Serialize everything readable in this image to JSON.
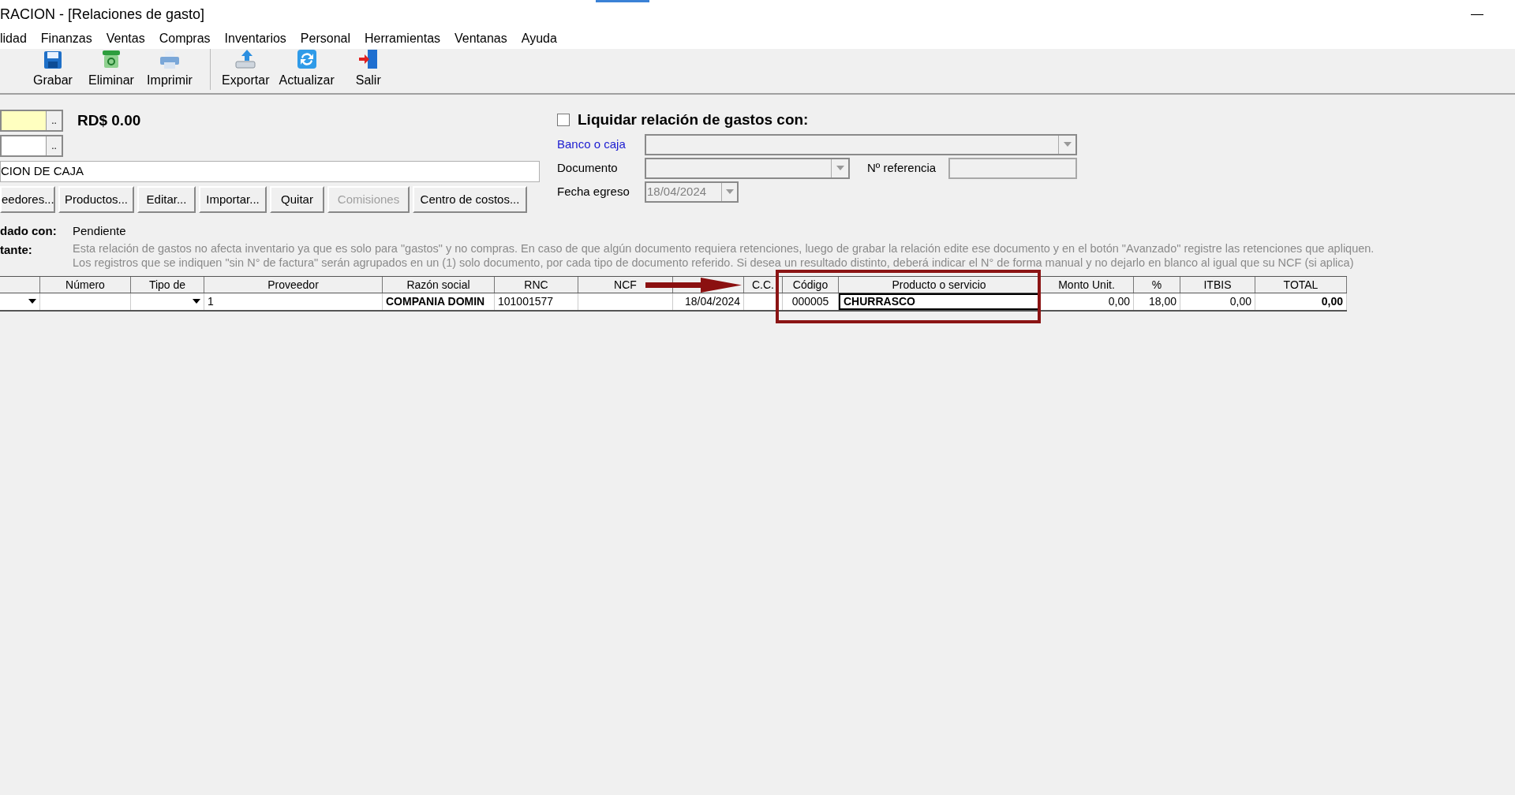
{
  "window": {
    "title": "RACION - [Relaciones de gasto]",
    "minimize": "—"
  },
  "menu": [
    "lidad",
    "Finanzas",
    "Ventas",
    "Compras",
    "Inventarios",
    "Personal",
    "Herramientas",
    "Ventanas",
    "Ayuda"
  ],
  "toolbar": [
    {
      "label": "Grabar",
      "kind": "save"
    },
    {
      "label": "Eliminar",
      "kind": "delete"
    },
    {
      "label": "Imprimir",
      "kind": "print"
    },
    {
      "label": "Exportar",
      "kind": "export"
    },
    {
      "label": "Actualizar",
      "kind": "refresh"
    },
    {
      "label": "Salir",
      "kind": "exit"
    }
  ],
  "form": {
    "field_1": {
      "browse": ".."
    },
    "total": "RD$ 0.00",
    "field_2": {
      "browse": ".."
    },
    "description": "CION DE CAJA",
    "buttons": [
      {
        "label": "eedores...",
        "disabled": false
      },
      {
        "label": "Productos...",
        "disabled": false
      },
      {
        "label": "Editar...",
        "disabled": false
      },
      {
        "label": "Importar...",
        "disabled": false
      },
      {
        "label": "Quitar",
        "disabled": false
      },
      {
        "label": "Comisiones",
        "disabled": true
      },
      {
        "label": "Centro de costos...",
        "disabled": false
      }
    ],
    "status_label": "dado con:",
    "status_value": "Pendiente",
    "note_label": "tante:",
    "note_lines": [
      "Esta relación de gastos no afecta inventario ya que es solo para \"gastos\" y no compras. En caso de que algún documento requiera retenciones, luego de grabar la relación edite ese documento y en el botón \"Avanzado\" registre las retenciones que apliquen.",
      "Los registros que se indiquen \"sin N° de factura\" serán agrupados en un (1) solo documento, por cada tipo de documento referido. Si desea un resultado distinto, deberá indicar el N° de forma manual y no dejarlo en blanco al igual que su NCF (si aplica)"
    ]
  },
  "settle": {
    "checked": false,
    "label": "Liquidar relación de gastos con:",
    "bank_label": "Banco o caja",
    "document_label": "Documento",
    "reference_label": "Nº referencia",
    "date_label": "Fecha egreso",
    "date_value": "18/04/2024"
  },
  "table": {
    "columns": [
      "",
      "Número",
      "Tipo de",
      "Proveedor",
      "Razón social",
      "RNC",
      "NCF",
      "",
      "C.C.",
      "Código",
      "Producto o servicio",
      "Monto Unit.",
      "%",
      "ITBIS",
      "TOTAL"
    ],
    "rows": [
      [
        "",
        "",
        "",
        "1",
        "COMPANIA DOMIN",
        "101001577",
        "",
        "18/04/2024",
        "",
        "000005",
        "CHURRASCO",
        "0,00",
        "18,00",
        "0,00",
        "0,00"
      ]
    ]
  }
}
